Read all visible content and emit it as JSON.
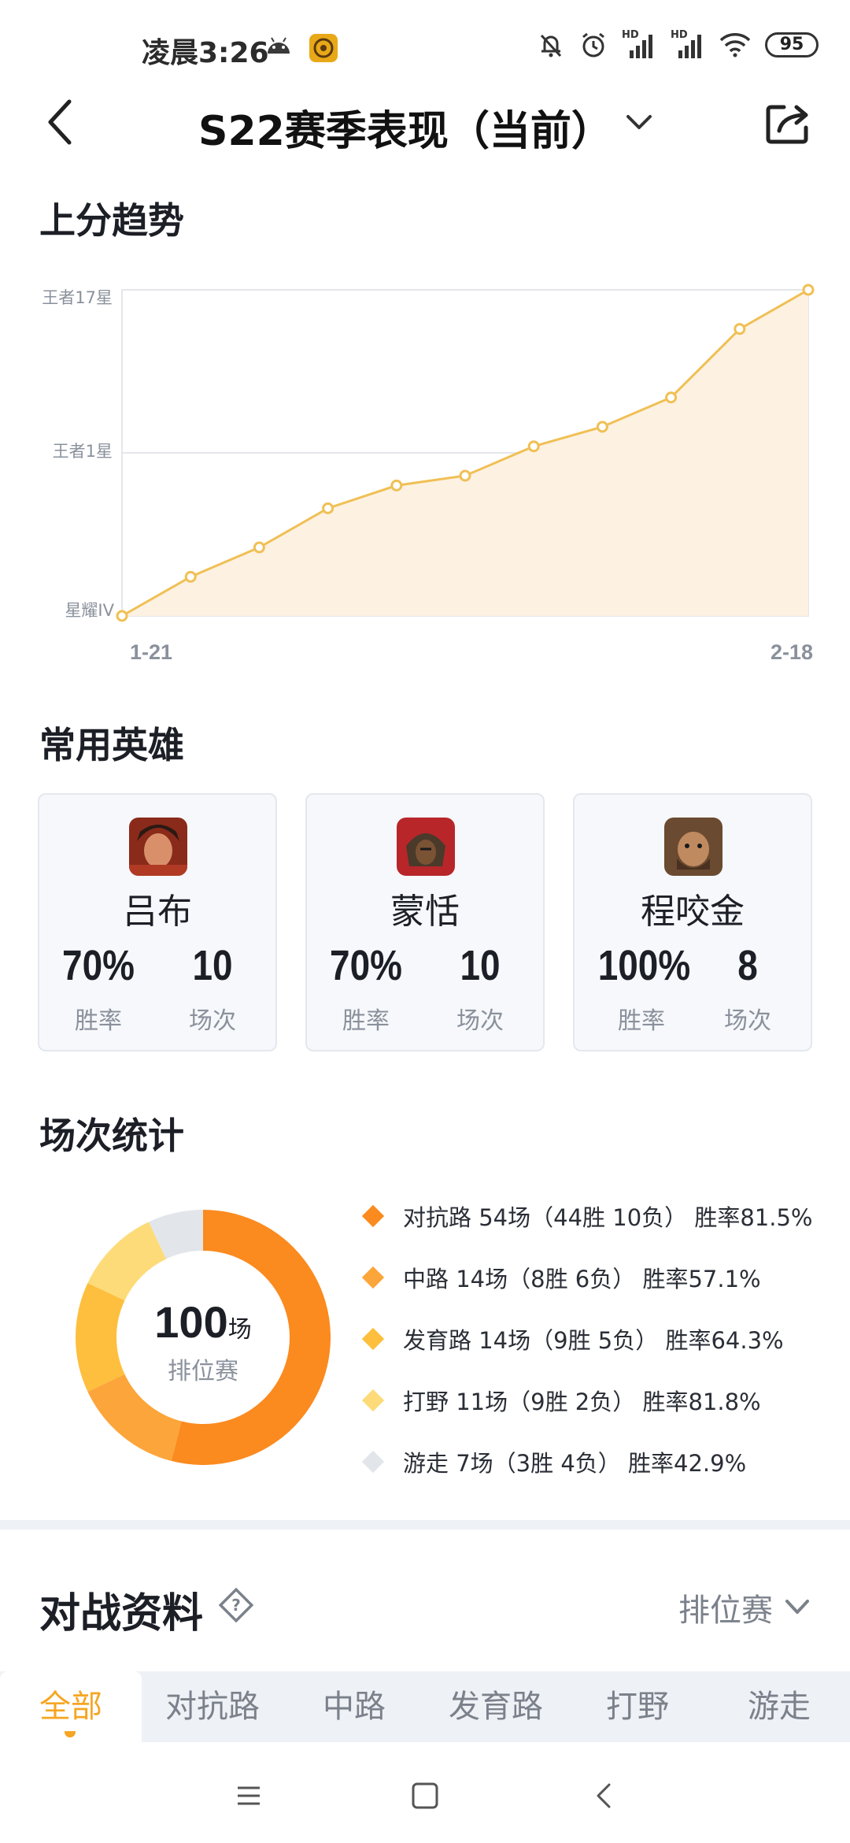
{
  "status_bar": {
    "time": "凌晨3:26",
    "battery": "95",
    "icons": [
      "android-icon",
      "app-notification-icon",
      "bell-off-icon",
      "alarm-icon",
      "signal-hd-icon",
      "signal-hd-icon",
      "wifi-icon"
    ]
  },
  "header": {
    "title": "S22赛季表现（当前）"
  },
  "trend": {
    "section_title": "上分趋势",
    "y_labels": [
      "王者17星",
      "王者1星",
      "星耀IV"
    ],
    "x_start": "1-21",
    "x_end": "2-18"
  },
  "chart_data": {
    "type": "area",
    "title": "上分趋势",
    "y_ticks": [
      "星耀IV",
      "王者1星",
      "王者17星"
    ],
    "x_labels": [
      "1-21",
      "2-18"
    ],
    "values": [
      0,
      0.12,
      0.21,
      0.33,
      0.4,
      0.43,
      0.52,
      0.58,
      0.67,
      0.88,
      1.0
    ],
    "grid": true,
    "colors": {
      "line": "#f0c055",
      "fill": "#fdf1e2"
    }
  },
  "heroes": {
    "section_title": "常用英雄",
    "items": [
      {
        "name": "吕布",
        "win_rate": "70%",
        "win_rate_label": "胜率",
        "games": "10",
        "games_label": "场次"
      },
      {
        "name": "蒙恬",
        "win_rate": "70%",
        "win_rate_label": "胜率",
        "games": "10",
        "games_label": "场次"
      },
      {
        "name": "程咬金",
        "win_rate": "100%",
        "win_rate_label": "胜率",
        "games": "8",
        "games_label": "场次"
      }
    ]
  },
  "stats": {
    "section_title": "场次统计",
    "total": "100",
    "total_unit": "场",
    "mode": "排位赛",
    "legend": [
      {
        "text": "对抗路 54场（44胜 10负） 胜率81.5%",
        "games": 54,
        "color": "#fb8a1f"
      },
      {
        "text": "中路 14场（8胜 6负） 胜率57.1%",
        "games": 14,
        "color": "#fca53a"
      },
      {
        "text": "发育路 14场（9胜 5负） 胜率64.3%",
        "games": 14,
        "color": "#fdbf3d"
      },
      {
        "text": "打野 11场（9胜 2负） 胜率81.8%",
        "games": 11,
        "color": "#fddb78"
      },
      {
        "text": "游走 7场（3胜 4负） 胜率42.9%",
        "games": 7,
        "color": "#e2e6ea"
      }
    ]
  },
  "battle": {
    "title": "对战资料",
    "mode_select": "排位赛",
    "tabs": [
      "全部",
      "对抗路",
      "中路",
      "发育路",
      "打野",
      "游走"
    ],
    "active_tab": "全部"
  }
}
